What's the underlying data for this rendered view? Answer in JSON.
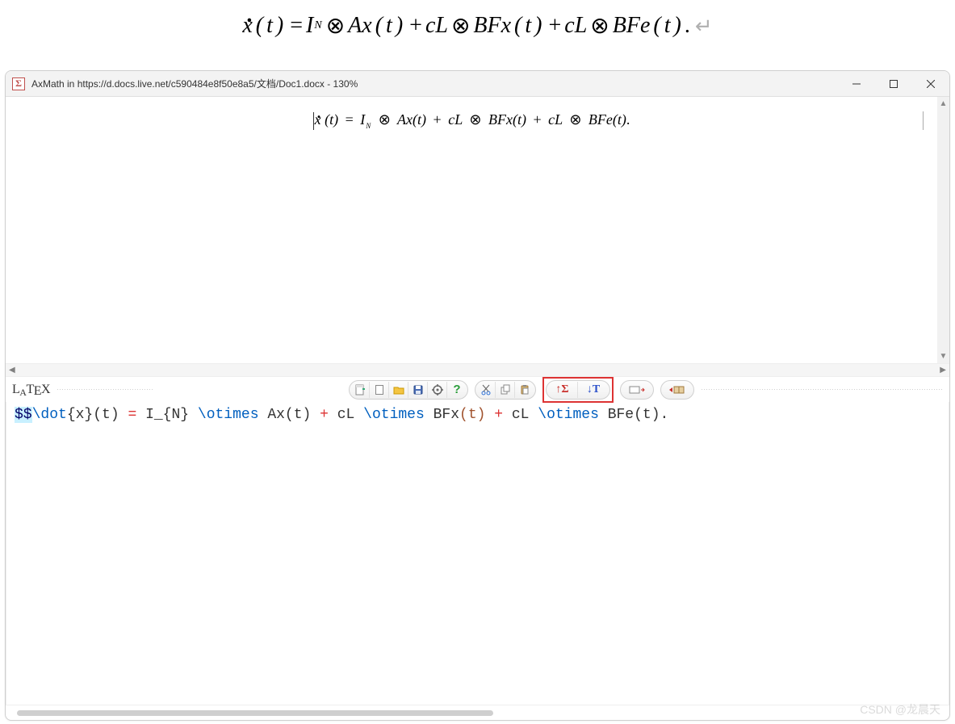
{
  "document": {
    "equation_display": "ẋ ( t ) = I_N ⊗ Ax ( t ) + cL ⊗ BFx ( t ) + cL ⊗ BFe ( t ).",
    "pilcrow": "↵"
  },
  "window": {
    "title": "AxMath in https://d.docs.live.net/c590484e8f50e8a5/文档/Doc1.docx - 130%",
    "app_icon_char": "Σ",
    "rendered_equation": "ẋ (t) = I_N ⊗ Ax(t) + cL ⊗ BFx(t) + cL ⊗ BFe(t)."
  },
  "toolbar": {
    "latex_label_parts": {
      "l": "L",
      "a": "A",
      "t": "T",
      "e": "E",
      "x": "X"
    },
    "icons": {
      "new_doc": "new-doc-icon",
      "copy_doc": "copy-doc-icon",
      "open": "folder-open-icon",
      "save": "save-icon",
      "settings": "gear-icon",
      "help": "question-icon",
      "cut": "scissors-icon",
      "copy": "copy-icon",
      "paste": "clipboard-icon",
      "to_formula": "red-sigma-up-icon",
      "to_text": "blue-t-down-icon",
      "snippet_left": "snippet-left-icon",
      "run": "run-book-icon"
    },
    "help_char": "?",
    "sigma_label": "↑Σ",
    "t_label": "↓T"
  },
  "latex_code": {
    "tokens": [
      {
        "t": "$$",
        "c": "delim"
      },
      {
        "t": "\\dot",
        "c": "cmd"
      },
      {
        "t": "{x}(t) ",
        "c": "text"
      },
      {
        "t": "=",
        "c": "op"
      },
      {
        "t": " I_{N} ",
        "c": "text"
      },
      {
        "t": "\\otimes",
        "c": "cmd"
      },
      {
        "t": " Ax(t) ",
        "c": "text"
      },
      {
        "t": "+",
        "c": "op"
      },
      {
        "t": " cL ",
        "c": "text"
      },
      {
        "t": "\\otimes",
        "c": "cmd"
      },
      {
        "t": " BFx",
        "c": "text"
      },
      {
        "t": "(t)",
        "c": "paren"
      },
      {
        "t": " ",
        "c": "text"
      },
      {
        "t": "+",
        "c": "op"
      },
      {
        "t": " cL ",
        "c": "text"
      },
      {
        "t": "\\otimes",
        "c": "cmd"
      },
      {
        "t": " BFe(t).",
        "c": "text"
      }
    ]
  },
  "watermark": "CSDN @龙晨天"
}
